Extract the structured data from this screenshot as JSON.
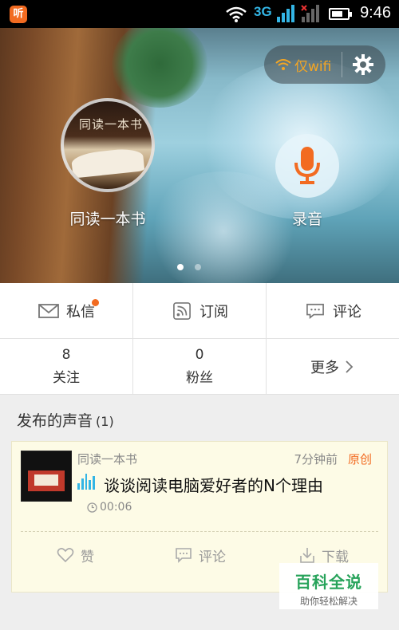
{
  "status_bar": {
    "app_icon": "listen-app-icon",
    "network": "3G",
    "time": "9:46"
  },
  "hero": {
    "wifi_only_label": "仅wifi",
    "avatar_label": "同读一本书",
    "avatar_image_text": "同读一本书",
    "record_label": "录音",
    "page_count": 2,
    "active_page": 1
  },
  "actions": {
    "messages": "私信",
    "subscribe": "订阅",
    "comments": "评论"
  },
  "stats": {
    "following_count": "8",
    "following_label": "关注",
    "fans_count": "0",
    "fans_label": "粉丝",
    "more_label": "更多"
  },
  "section": {
    "title": "发布的声音",
    "count": "(1)"
  },
  "post": {
    "author": "同读一本书",
    "time_ago": "7分钟前",
    "original_tag": "原创",
    "title": "谈谈阅读电脑爱好者的N个理由",
    "duration": "00:06",
    "like_label": "赞",
    "comment_label": "评论",
    "download_label": "下载"
  },
  "watermark": {
    "title": "百科全说",
    "subtitle": "助你轻松解决"
  },
  "colors": {
    "accent": "#f26b21",
    "blue": "#33b5e5",
    "card_bg": "#fdfbe6"
  }
}
